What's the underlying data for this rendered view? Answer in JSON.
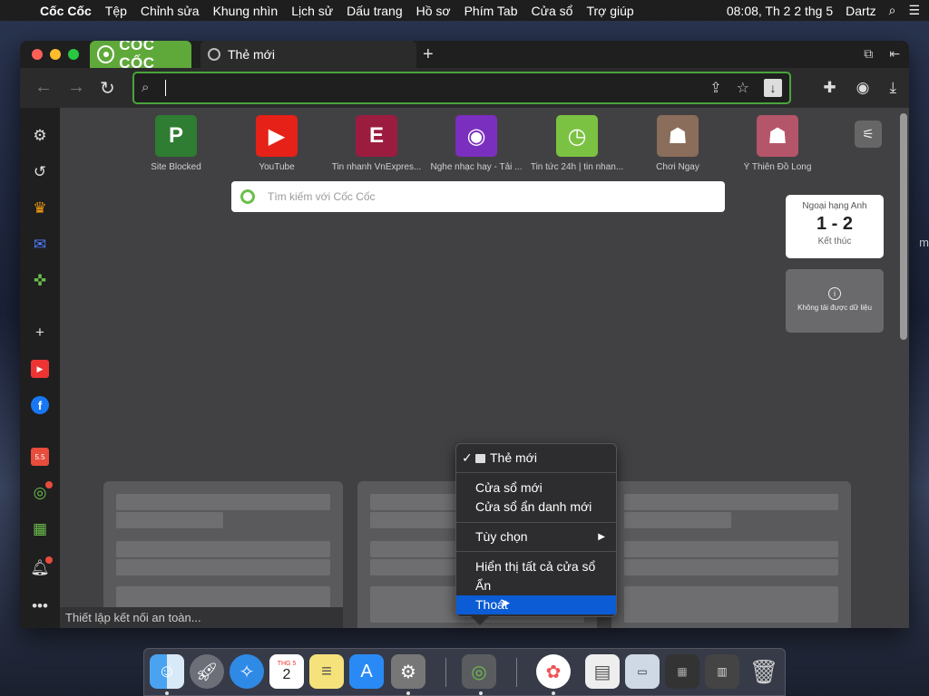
{
  "menubar": {
    "app_name": "Cốc Cốc",
    "items": [
      "Tệp",
      "Chỉnh sửa",
      "Khung nhìn",
      "Lịch sử",
      "Dấu trang",
      "Hồ sơ",
      "Phím Tab",
      "Cửa sổ",
      "Trợ giúp"
    ],
    "clock": "08:08, Th 2 2 thg 5",
    "user": "Dartz"
  },
  "browser": {
    "brand_label": "CỐC CỐC",
    "active_tab_title": "Thẻ mới",
    "omnibox_value": ""
  },
  "shortcuts": [
    {
      "label": "Site Blocked",
      "glyph": "P",
      "color": "#2e7d32"
    },
    {
      "label": "YouTube",
      "glyph": "▶",
      "color": "#e62117"
    },
    {
      "label": "Tin nhanh VnExpres...",
      "glyph": "E",
      "color": "#9b1c3f"
    },
    {
      "label": "Nghe nhạc hay - Tải ...",
      "glyph": "◉",
      "color": "#7b2fbf"
    },
    {
      "label": "Tin tức 24h | tin nhan...",
      "glyph": "◷",
      "color": "#7cc242"
    },
    {
      "label": "Chơi Ngay",
      "glyph": "☗",
      "color": "#8a6d5a"
    },
    {
      "label": "Ỷ Thiên Đồ Long",
      "glyph": "☗",
      "color": "#b5556a"
    }
  ],
  "search": {
    "placeholder": "Tìm kiếm với Cốc Cốc"
  },
  "score_widget": {
    "league": "Ngoại hạng Anh",
    "result": "1 - 2",
    "status": "Kết thúc"
  },
  "error_widget": {
    "text": "Không tải được dữ liệu"
  },
  "status_bar": "Thiết lập kết nối an toàn...",
  "context_menu": {
    "current": "Thẻ mới",
    "items": [
      "Cửa sổ mới",
      "Cửa sổ ẩn danh mới",
      "Tùy chọn",
      "Hiển thị tất cả cửa sổ",
      "Ẩn",
      "Thoát"
    ]
  },
  "dock": {
    "apps": [
      "finder",
      "launchpad",
      "safari",
      "calendar",
      "notes",
      "app-store",
      "system-preferences",
      "coc-coc",
      "photos",
      "preview",
      "screenshot-1",
      "screenshot-2",
      "screenshot-3",
      "trash"
    ],
    "calendar_day": "2",
    "calendar_month": "THG 5"
  }
}
